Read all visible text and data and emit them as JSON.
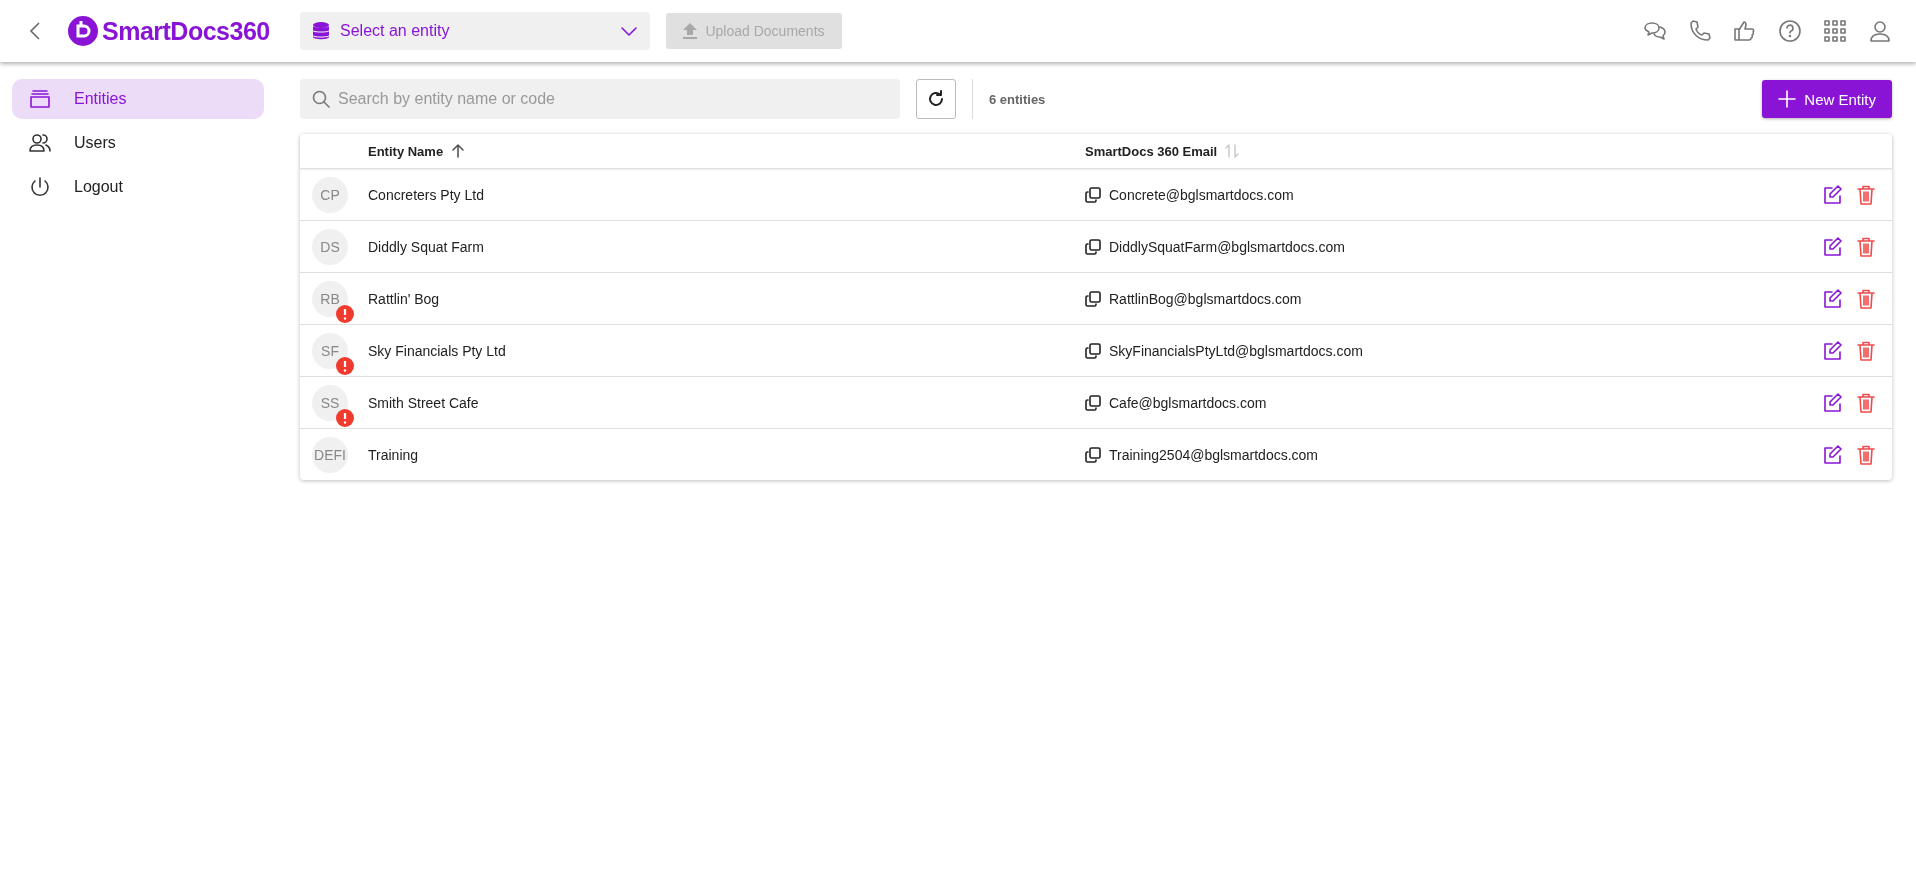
{
  "header": {
    "logo": "SmartDocs360",
    "entity_select": {
      "placeholder": "Select an entity"
    },
    "upload_button": {
      "label": "Upload Documents",
      "disabled": true
    }
  },
  "sidebar": {
    "items": [
      {
        "label": "Entities",
        "selected": true
      },
      {
        "label": "Users",
        "selected": false
      },
      {
        "label": "Logout",
        "selected": false
      }
    ]
  },
  "toolbar": {
    "search": {
      "placeholder": "Search by entity name or code"
    },
    "count": "6 entities",
    "new_button": "New Entity"
  },
  "table": {
    "columns": [
      {
        "label": "Entity Name",
        "sorted": true
      },
      {
        "label": "SmartDocs 360 Email",
        "sorted": false
      }
    ],
    "rows": [
      {
        "initials": "CP",
        "name": "Concreters Pty Ltd",
        "email": "Concrete@bglsmartdocs.com",
        "warning": false
      },
      {
        "initials": "DS",
        "name": "Diddly Squat Farm",
        "email": "DiddlySquatFarm@bglsmartdocs.com",
        "warning": false
      },
      {
        "initials": "RB",
        "name": "Rattlin' Bog",
        "email": "RattlinBog@bglsmartdocs.com",
        "warning": true
      },
      {
        "initials": "SF",
        "name": "Sky Financials Pty Ltd",
        "email": "SkyFinancialsPtyLtd@bglsmartdocs.com",
        "warning": true
      },
      {
        "initials": "SS",
        "name": "Smith Street Cafe",
        "email": "Cafe@bglsmartdocs.com",
        "warning": true
      },
      {
        "initials": "DEFI",
        "name": "Training",
        "email": "Training2504@bglsmartdocs.com",
        "warning": false
      }
    ]
  }
}
